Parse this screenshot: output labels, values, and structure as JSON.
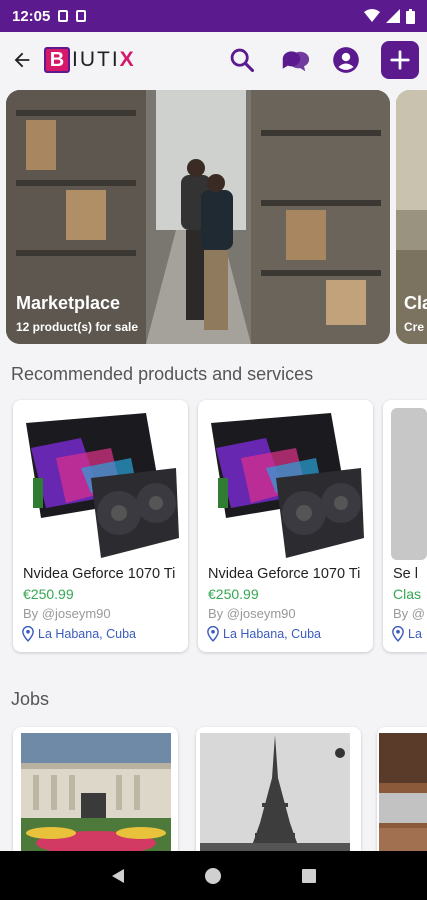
{
  "status": {
    "time": "12:05"
  },
  "brand": {
    "first": "B",
    "rest": "IUTI",
    "last": "X"
  },
  "hero": [
    {
      "title": "Marketplace",
      "subtitle": "12 product(s) for sale"
    },
    {
      "title": "Cla",
      "subtitle": "Cre"
    }
  ],
  "sections": {
    "recommended": "Recommended products and services",
    "jobs": "Jobs"
  },
  "products": [
    {
      "name": "Nvidea Geforce 1070 Ti",
      "price": "€250.99",
      "by": "By @joseym90",
      "location": "La Habana, Cuba"
    },
    {
      "name": "Nvidea Geforce 1070 Ti",
      "price": "€250.99",
      "by": "By @joseym90",
      "location": "La Habana, Cuba"
    },
    {
      "name": "Se l",
      "price": "Clas",
      "by": "By @",
      "location": "La"
    }
  ],
  "colors": {
    "brand_purple": "#5b1a8e",
    "brand_pink": "#d6186a",
    "price_green": "#34a853",
    "location_blue": "#3b5bbf"
  }
}
